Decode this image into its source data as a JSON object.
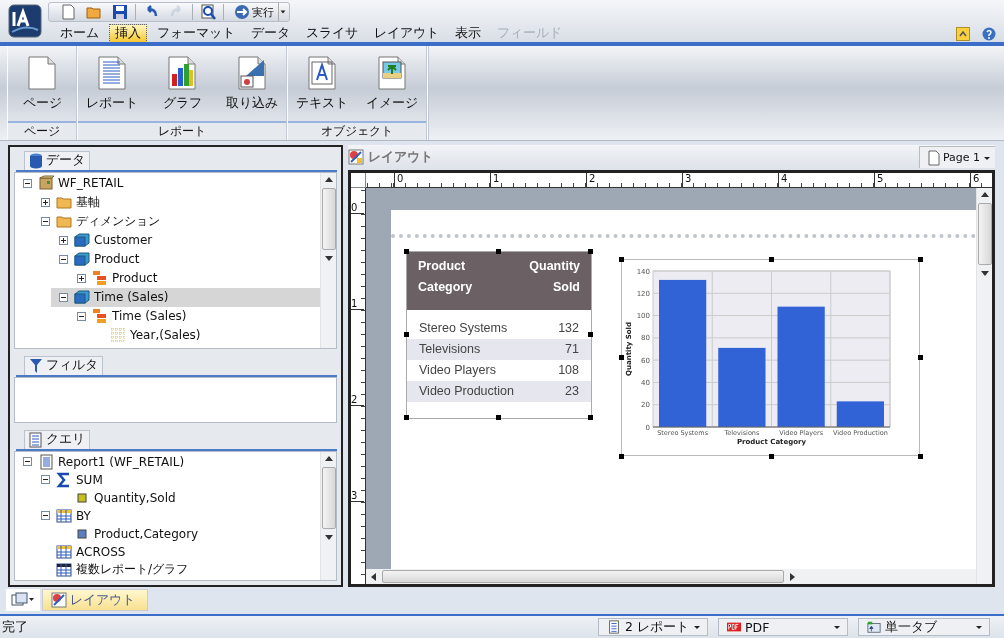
{
  "quick_toolbar": {
    "run_label": "実行",
    "tools": [
      {
        "kind": "new",
        "disabled": false
      },
      {
        "kind": "open",
        "disabled": false
      },
      {
        "kind": "save",
        "disabled": false
      },
      {
        "kind": "undo",
        "disabled": false
      },
      {
        "kind": "redo",
        "disabled": true
      },
      {
        "kind": "preview",
        "disabled": false
      }
    ]
  },
  "menu_tabs": [
    {
      "label": "ホーム",
      "selected": false,
      "disabled": false
    },
    {
      "label": "挿入",
      "selected": true,
      "disabled": false
    },
    {
      "label": "フォーマット",
      "selected": false,
      "disabled": false
    },
    {
      "label": "データ",
      "selected": false,
      "disabled": false
    },
    {
      "label": "スライサ",
      "selected": false,
      "disabled": false
    },
    {
      "label": "レイアウト",
      "selected": false,
      "disabled": false
    },
    {
      "label": "表示",
      "selected": false,
      "disabled": false
    },
    {
      "label": "フィールド",
      "selected": false,
      "disabled": true
    }
  ],
  "ribbon": {
    "groups": [
      {
        "label": "ページ",
        "buttons": [
          {
            "label": "ページ",
            "kind": "page"
          }
        ]
      },
      {
        "label": "レポート",
        "buttons": [
          {
            "label": "レポート",
            "kind": "report"
          },
          {
            "label": "グラフ",
            "kind": "chart"
          },
          {
            "label": "取り込み",
            "kind": "import"
          }
        ]
      },
      {
        "label": "オブジェクト",
        "buttons": [
          {
            "label": "テキスト",
            "kind": "text"
          },
          {
            "label": "イメージ",
            "kind": "image"
          }
        ]
      }
    ]
  },
  "data_panel": {
    "title": "データ",
    "tree": [
      {
        "label": "WF_RETAIL",
        "kind": "database",
        "expanded": true,
        "selected": false,
        "children": [
          {
            "label": "基軸",
            "kind": "folder",
            "expanded": false,
            "selected": false
          },
          {
            "label": "ディメンション",
            "kind": "folder",
            "expanded": true,
            "selected": false,
            "children": [
              {
                "label": "Customer",
                "kind": "cube",
                "expanded": false,
                "selected": false
              },
              {
                "label": "Product",
                "kind": "cube",
                "expanded": true,
                "selected": false,
                "children": [
                  {
                    "label": "Product",
                    "kind": "hierarchy",
                    "expanded": false,
                    "selected": false
                  }
                ]
              },
              {
                "label": "Time (Sales)",
                "kind": "cube",
                "expanded": true,
                "selected": true,
                "children": [
                  {
                    "label": "Time (Sales)",
                    "kind": "hierarchy",
                    "expanded": true,
                    "selected": false,
                    "children": [
                      {
                        "label": "Year,(Sales)",
                        "kind": "grid",
                        "selected": false
                      }
                    ]
                  }
                ]
              }
            ]
          }
        ]
      }
    ]
  },
  "filter_panel": {
    "title": "フィルタ"
  },
  "query_panel": {
    "title": "クエリ",
    "tree": [
      {
        "label": "Report1 (WF_RETAIL)",
        "kind": "report",
        "expanded": true,
        "children": [
          {
            "label": "SUM",
            "kind": "sigma",
            "expanded": true,
            "children": [
              {
                "label": "Quantity,Sold",
                "kind": "measure"
              }
            ]
          },
          {
            "label": "BY",
            "kind": "table",
            "expanded": true,
            "children": [
              {
                "label": "Product,Category",
                "kind": "dimension"
              }
            ]
          },
          {
            "label": "ACROSS",
            "kind": "table"
          },
          {
            "label": "複数レポート/グラフ",
            "kind": "table-dark"
          }
        ]
      }
    ]
  },
  "layout_panel": {
    "title": "レイアウト",
    "page_button": "Page 1",
    "ruler": {
      "horizontal": [
        "0",
        "1",
        "2",
        "3",
        "4",
        "5",
        "6"
      ],
      "vertical": [
        "0",
        "1",
        "2",
        "3"
      ]
    },
    "report": {
      "columns": [
        {
          "label": "Product Category"
        },
        {
          "label": "Quantity Sold"
        }
      ],
      "rows": [
        [
          "Stereo Systems",
          "132"
        ],
        [
          "Televisions",
          "71"
        ],
        [
          "Video Players",
          "108"
        ],
        [
          "Video Production",
          "23"
        ]
      ]
    },
    "chart": {
      "chart_data": {
        "type": "bar",
        "xlabel": "Product Category",
        "ylabel": "Quantity Sold",
        "categories": [
          "Stereo Systems",
          "Televisions",
          "Video Players",
          "Video Production"
        ],
        "series": [
          {
            "color": "#3163d6",
            "values": [
              132,
              71,
              108,
              23
            ]
          }
        ],
        "grid": true,
        "ylim": [
          0,
          140
        ],
        "yticks": [
          0,
          20,
          40,
          60,
          80,
          100,
          120,
          140
        ]
      }
    }
  },
  "bottom_tabs": [
    {
      "label": "レイアウト",
      "selected": true
    }
  ],
  "status_bar": {
    "text": "完了",
    "reports": "2 レポート",
    "format": "PDF",
    "tab_mode": "単一タブ"
  }
}
